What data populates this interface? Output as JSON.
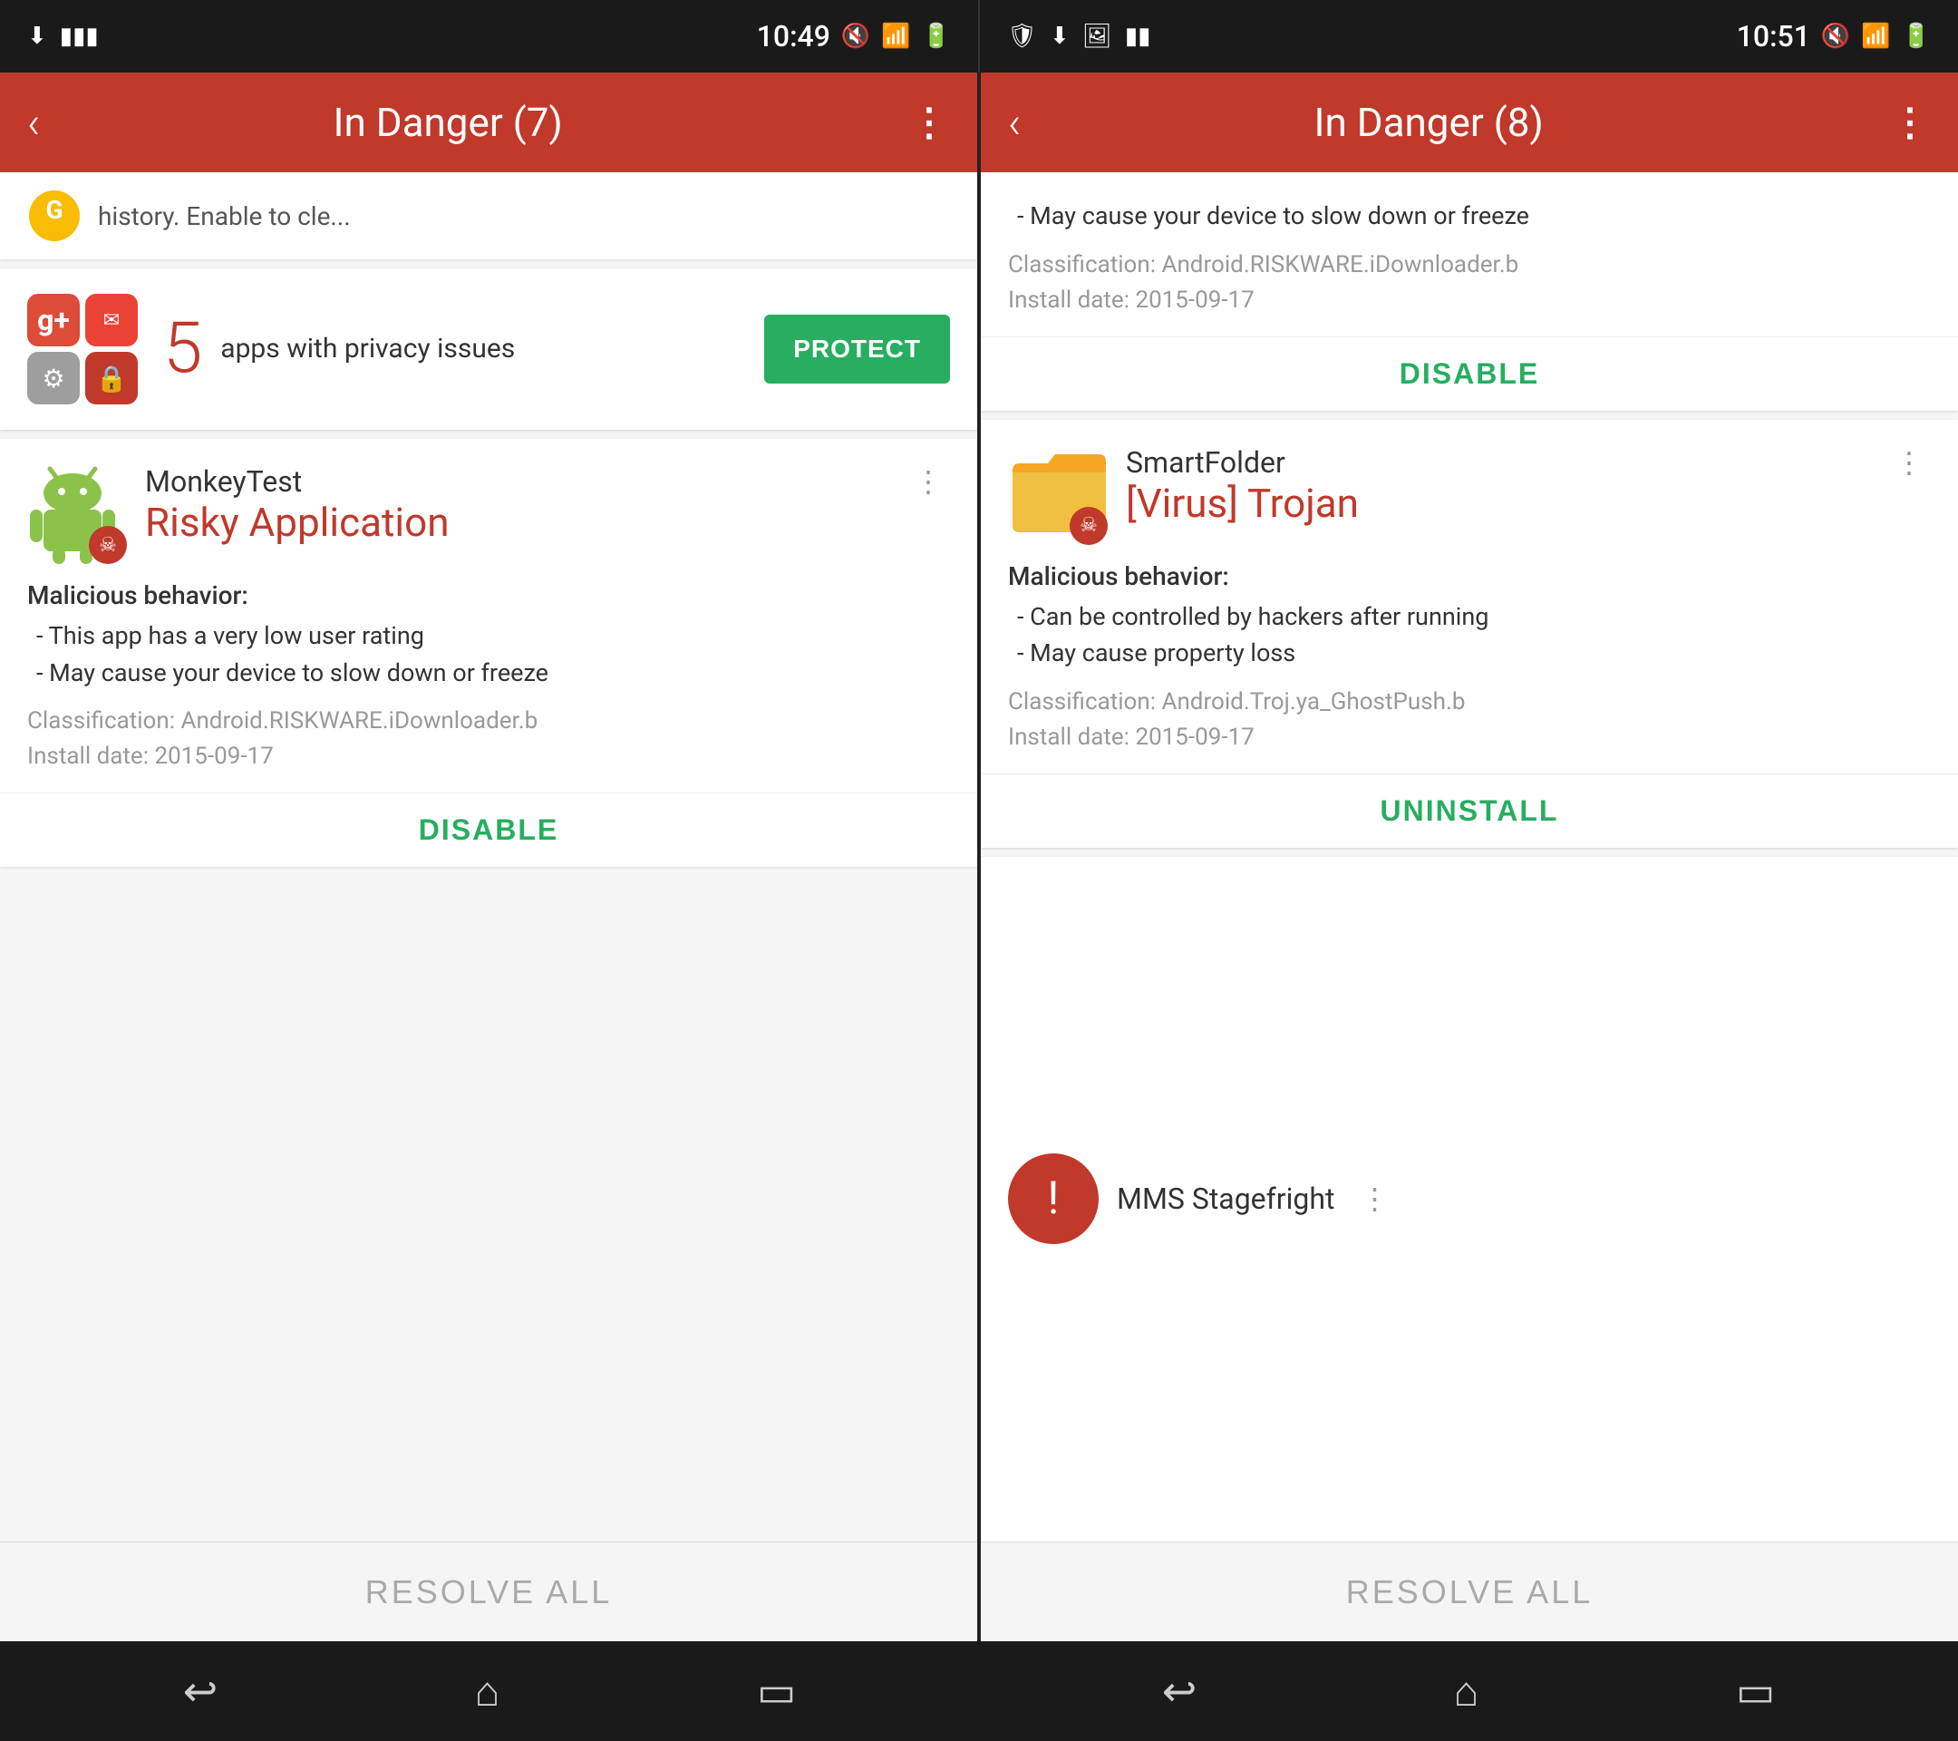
{
  "left_panel": {
    "status_bar": {
      "time": "10:49",
      "icons_left": [
        "download-icon",
        "bars-icon"
      ],
      "icons_right": [
        "mute-icon",
        "wifi-icon",
        "signal-icon",
        "battery-icon"
      ]
    },
    "header": {
      "title": "In Danger (7)",
      "back_label": "‹",
      "more_label": "⋮"
    },
    "top_snippet": {
      "text": "history. Enable to cle..."
    },
    "privacy_card": {
      "count": "5",
      "text": "apps with privacy issues",
      "protect_label": "PROTECT"
    },
    "threat_card": {
      "app_name": "MonkeyTest",
      "threat_label": "Risky Application",
      "behavior_title": "Malicious behavior:",
      "behavior_items": [
        "- This app has a very low user rating",
        "- May cause your device to slow down or freeze"
      ],
      "classification_label": "Classification:",
      "classification_value": "Android.RISKWARE.iDownloader.b",
      "install_date_label": "Install date:",
      "install_date_value": "2015-09-17",
      "action_label": "DISABLE"
    },
    "resolve_all": {
      "label": "RESOLVE ALL"
    }
  },
  "right_panel": {
    "status_bar": {
      "time": "10:51",
      "icons_left": [
        "shield-icon",
        "download-icon",
        "image-icon",
        "bars-icon"
      ],
      "icons_right": [
        "mute-icon",
        "wifi-icon",
        "signal-icon",
        "battery-icon"
      ]
    },
    "header": {
      "title": "In Danger (8)",
      "back_label": "‹",
      "more_label": "⋮"
    },
    "top_card": {
      "behavior_items": [
        "- May cause your device to slow down or freeze"
      ],
      "classification_label": "Classification:",
      "classification_value": "Android.RISKWARE.iDownloader.b",
      "install_date_label": "Install date:",
      "install_date_value": "2015-09-17",
      "action_label": "DISABLE"
    },
    "threat_card": {
      "app_name": "SmartFolder",
      "threat_label": "[Virus] Trojan",
      "behavior_title": "Malicious behavior:",
      "behavior_items": [
        "- Can be controlled by hackers after running",
        "- May cause property loss"
      ],
      "classification_label": "Classification:",
      "classification_value": "Android.Troj.ya_GhostPush.b",
      "install_date_label": "Install date:",
      "install_date_value": "2015-09-17",
      "action_label": "UNINSTALL"
    },
    "partial_card": {
      "app_name": "MMS Stagefright"
    },
    "resolve_all": {
      "label": "RESOLVE ALL"
    }
  },
  "bottom_nav": {
    "back_label": "↩",
    "home_label": "⌂",
    "recents_label": "▭"
  }
}
